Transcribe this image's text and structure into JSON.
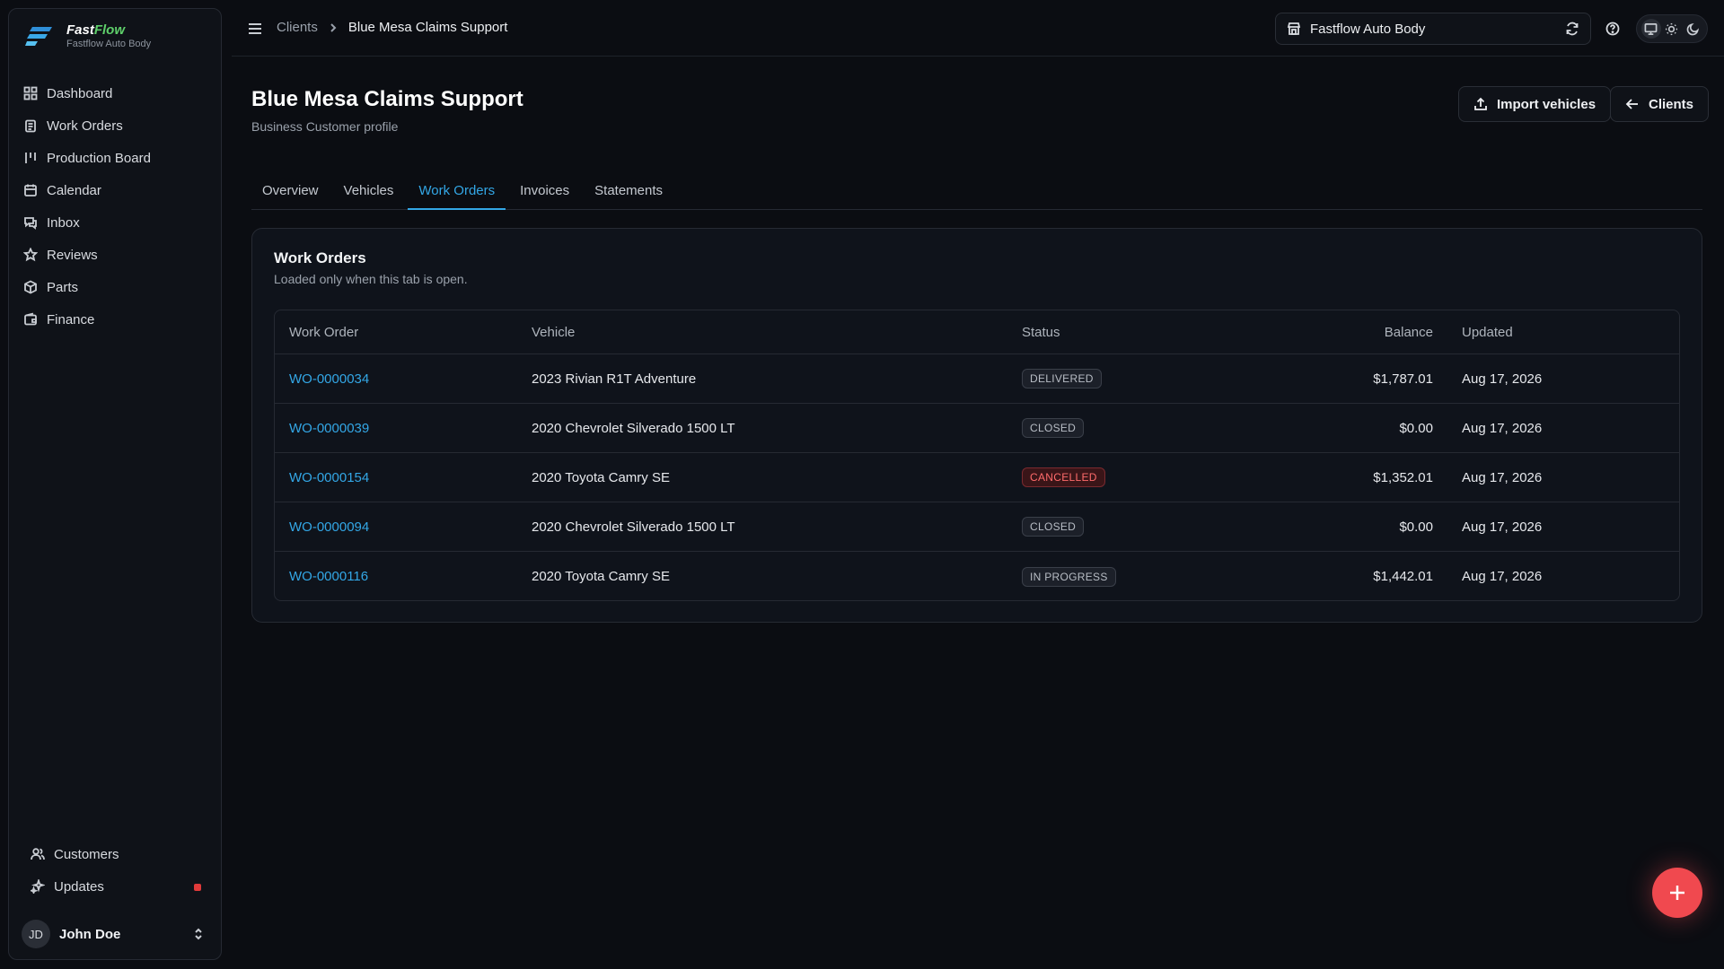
{
  "brand": {
    "name_part1": "Fast",
    "name_part2": "Flow",
    "subtitle": "Fastflow Auto Body",
    "accent_color": "#5ecf6a"
  },
  "sidebar": {
    "items": [
      {
        "label": "Dashboard",
        "icon": "grid-icon"
      },
      {
        "label": "Work Orders",
        "icon": "clipboard-icon"
      },
      {
        "label": "Production Board",
        "icon": "kanban-icon"
      },
      {
        "label": "Calendar",
        "icon": "calendar-icon"
      },
      {
        "label": "Inbox",
        "icon": "chat-icon"
      },
      {
        "label": "Reviews",
        "icon": "star-icon"
      },
      {
        "label": "Parts",
        "icon": "box-icon"
      },
      {
        "label": "Finance",
        "icon": "wallet-icon"
      }
    ],
    "bottom_items": [
      {
        "label": "Customers",
        "icon": "users-icon"
      },
      {
        "label": "Updates",
        "icon": "sparkles-icon"
      }
    ],
    "user": {
      "initials": "JD",
      "name": "John Doe"
    }
  },
  "topbar": {
    "breadcrumb": {
      "parent": "Clients",
      "current": "Blue Mesa Claims Support"
    },
    "shop_select": {
      "value": "Fastflow Auto Body"
    }
  },
  "header": {
    "title": "Blue Mesa Claims Support",
    "subtitle": "Business Customer profile",
    "import_label": "Import vehicles",
    "back_label": "Clients"
  },
  "tabs": [
    {
      "label": "Overview"
    },
    {
      "label": "Vehicles"
    },
    {
      "label": "Work Orders",
      "active": true
    },
    {
      "label": "Invoices"
    },
    {
      "label": "Statements"
    }
  ],
  "card": {
    "title": "Work Orders",
    "subtitle": "Loaded only when this tab is open.",
    "columns": {
      "work_order": "Work Order",
      "vehicle": "Vehicle",
      "status": "Status",
      "balance": "Balance",
      "updated": "Updated"
    },
    "rows": [
      {
        "wo": "WO-0000034",
        "vehicle": "2023 Rivian R1T Adventure",
        "status": "DELIVERED",
        "status_color": "#b8bdc5",
        "balance": "$1,787.01",
        "updated": "Aug 17, 2026"
      },
      {
        "wo": "WO-0000039",
        "vehicle": "2020 Chevrolet Silverado 1500 LT",
        "status": "CLOSED",
        "status_color": "#b8bdc5",
        "balance": "$0.00",
        "updated": "Aug 17, 2026"
      },
      {
        "wo": "WO-0000154",
        "vehicle": "2020 Toyota Camry SE",
        "status": "CANCELLED",
        "status_color": "#ff6b6b",
        "balance": "$1,352.01",
        "updated": "Aug 17, 2026"
      },
      {
        "wo": "WO-0000094",
        "vehicle": "2020 Chevrolet Silverado 1500 LT",
        "status": "CLOSED",
        "status_color": "#b8bdc5",
        "balance": "$0.00",
        "updated": "Aug 17, 2026"
      },
      {
        "wo": "WO-0000116",
        "vehicle": "2020 Toyota Camry SE",
        "status": "IN PROGRESS",
        "status_color": "#b8bdc5",
        "balance": "$1,442.01",
        "updated": "Aug 17, 2026"
      }
    ]
  },
  "colors": {
    "link": "#33a7e6",
    "fab": "#f0494f",
    "background": "#0b0d12"
  }
}
